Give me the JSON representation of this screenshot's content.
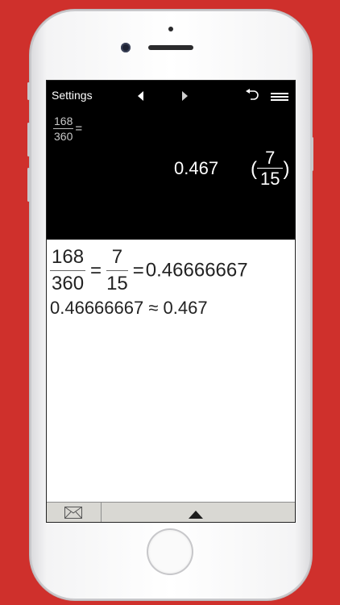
{
  "topbar": {
    "settings_label": "Settings"
  },
  "display": {
    "expression": {
      "numerator": "168",
      "denominator": "360",
      "equals": "="
    },
    "decimal_result": "0.467",
    "fraction_result": {
      "open_paren": "(",
      "numerator": "7",
      "denominator": "15",
      "close_paren": ")"
    }
  },
  "work": {
    "line1": {
      "frac1": {
        "numerator": "168",
        "denominator": "360"
      },
      "eq1": "=",
      "frac2": {
        "numerator": "7",
        "denominator": "15"
      },
      "eq2": "=",
      "decimal": "0.46666667"
    },
    "line2": "0.46666667 ≈ 0.467"
  },
  "icons": {
    "nav_back": "nav-left-arrow-icon",
    "nav_forward": "nav-right-arrow-icon",
    "undo": "undo-icon",
    "menu": "menu-icon",
    "mail": "envelope-icon",
    "expand": "triangle-up-icon"
  },
  "colors": {
    "background": "#cf302c",
    "display_bg": "#000000",
    "bottom_bar": "#d9d8d3"
  }
}
